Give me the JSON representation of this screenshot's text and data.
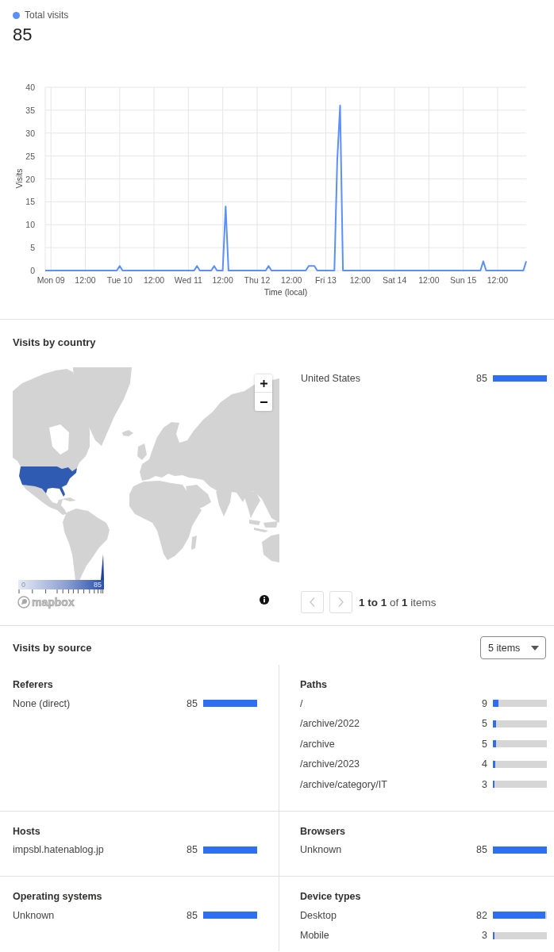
{
  "visits_chart": {
    "total": "85",
    "chart_data": {
      "type": "line",
      "xlabel": "Time (local)",
      "ylabel": "Visits",
      "grid": true,
      "categories": [
        null,
        null,
        "Mon 09",
        null,
        null,
        null,
        null,
        null,
        null,
        null,
        null,
        null,
        null,
        null,
        "12:00",
        null,
        null,
        null,
        null,
        null,
        null,
        null,
        null,
        null,
        null,
        null,
        "Tue 10",
        null,
        null,
        null,
        null,
        null,
        null,
        null,
        null,
        null,
        null,
        null,
        "12:00",
        null,
        null,
        null,
        null,
        null,
        null,
        null,
        null,
        null,
        null,
        null,
        "Wed 11",
        null,
        null,
        null,
        null,
        null,
        null,
        null,
        null,
        null,
        null,
        null,
        "12:00",
        null,
        null,
        null,
        null,
        null,
        null,
        null,
        null,
        null,
        null,
        null,
        "Thu 12",
        null,
        null,
        null,
        null,
        null,
        null,
        null,
        null,
        null,
        null,
        null,
        "12:00",
        null,
        null,
        null,
        null,
        null,
        null,
        null,
        null,
        null,
        null,
        null,
        "Fri 13",
        null,
        null,
        null,
        null,
        null,
        null,
        null,
        null,
        null,
        null,
        null,
        "12:00",
        null,
        null,
        null,
        null,
        null,
        null,
        null,
        null,
        null,
        null,
        null,
        "Sat 14",
        null,
        null,
        null,
        null,
        null,
        null,
        null,
        null,
        null,
        null,
        null,
        "12:00",
        null,
        null,
        null,
        null,
        null,
        null,
        null,
        null,
        null,
        null,
        null,
        "Sun 15",
        null,
        null,
        null,
        null,
        null,
        null,
        null,
        null,
        null,
        null,
        null,
        "12:00",
        null,
        null,
        null,
        null,
        null,
        null,
        null,
        null,
        null,
        null
      ],
      "series": [
        {
          "name": "Total visits",
          "color": "#5b8ff9",
          "values": [
            0,
            0,
            0,
            0,
            0,
            0,
            0,
            0,
            0,
            0,
            0,
            0,
            0,
            0,
            0,
            0,
            0,
            0,
            0,
            0,
            0,
            0,
            0,
            0,
            0,
            0,
            1,
            0,
            0,
            0,
            0,
            0,
            0,
            0,
            0,
            0,
            0,
            0,
            0,
            0,
            0,
            0,
            0,
            0,
            0,
            0,
            0,
            0,
            0,
            0,
            0,
            0,
            0,
            1,
            0,
            0,
            0,
            0,
            0,
            1,
            0,
            0,
            0,
            14,
            0,
            0,
            0,
            0,
            0,
            0,
            0,
            0,
            0,
            0,
            0,
            0,
            0,
            0,
            1,
            0,
            0,
            0,
            0,
            0,
            0,
            0,
            0,
            0,
            0,
            0,
            0,
            0,
            1,
            1,
            1,
            0,
            0,
            0,
            0,
            0,
            0,
            0,
            24,
            36,
            0,
            0,
            0,
            0,
            0,
            0,
            0,
            0,
            0,
            0,
            0,
            0,
            0,
            0,
            0,
            0,
            0,
            0,
            0,
            0,
            0,
            0,
            0,
            0,
            0,
            0,
            0,
            0,
            0,
            0,
            0,
            0,
            0,
            0,
            0,
            0,
            0,
            0,
            0,
            0,
            0,
            0,
            0,
            0,
            0,
            0,
            0,
            0,
            0,
            2,
            0,
            0,
            0,
            0,
            0,
            0,
            0,
            0,
            0,
            0,
            0,
            0,
            0,
            0,
            2
          ]
        }
      ],
      "ylim": [
        0,
        40
      ],
      "yticks": [
        0,
        5,
        10,
        15,
        20,
        25,
        30,
        35,
        40
      ]
    }
  },
  "visits_by_country": {
    "title": "Visits by country",
    "map": {
      "scale_min": "0",
      "scale_max": "85",
      "attribution": "mapbox"
    },
    "rows": [
      {
        "name": "United States",
        "value": "85",
        "level": 1
      }
    ],
    "pagination": {
      "buttons": [
        {
          "kind": "previous",
          "disabled": true
        },
        {
          "kind": "next",
          "disabled": true
        }
      ],
      "summary": "**1 to 1** of **1** items"
    }
  },
  "visits_by_source": {
    "title": "Visits by source",
    "dropdown": {
      "value": "5 items"
    },
    "panels": [
      {
        "title": "Referers",
        "rows": [
          {
            "name": "None (direct)",
            "value": "85",
            "level": 1
          }
        ]
      },
      {
        "title": "Paths",
        "rows": [
          {
            "name": "/",
            "value": "9",
            "level": 0.106
          },
          {
            "name": "/archive/2022",
            "value": "5",
            "level": 0.059
          },
          {
            "name": "/archive",
            "value": "5",
            "level": 0.059
          },
          {
            "name": "/archive/2023",
            "value": "4",
            "level": 0.047
          },
          {
            "name": "/archive/category/IT",
            "value": "3",
            "level": 0.035
          }
        ]
      },
      {
        "title": "Hosts",
        "rows": [
          {
            "name": "impsbl.hatenablog.jp",
            "value": "85",
            "level": 1
          }
        ]
      },
      {
        "title": "Browsers",
        "rows": [
          {
            "name": "Unknown",
            "value": "85",
            "level": 1
          }
        ]
      },
      {
        "title": "Operating systems",
        "rows": [
          {
            "name": "Unknown",
            "value": "85",
            "level": 1
          }
        ]
      },
      {
        "title": "Device types",
        "rows": [
          {
            "name": "Desktop",
            "value": "82",
            "level": 0.965
          },
          {
            "name": "Mobile",
            "value": "3",
            "level": 0.035
          }
        ]
      }
    ]
  }
}
